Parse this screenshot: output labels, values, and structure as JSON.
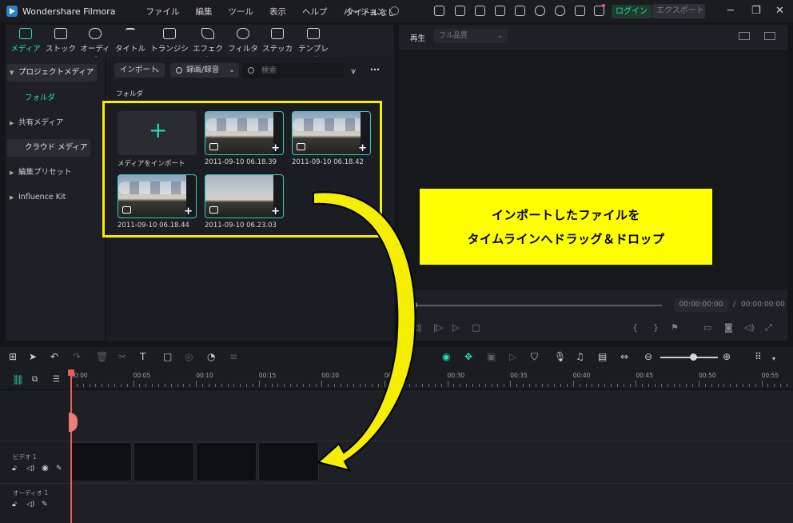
{
  "app": {
    "title": "Wondershare Filmora",
    "project_title": "タイトルなし"
  },
  "menu": [
    "ファイル",
    "編集",
    "ツール",
    "表示",
    "ヘルプ",
    "バージョン"
  ],
  "header": {
    "login_label": "ログイン",
    "export_label": "エクスポート"
  },
  "tools": [
    {
      "label": "メディア",
      "icon": "media-icon"
    },
    {
      "label": "ストック",
      "icon": "stock-icon"
    },
    {
      "label": "オーディオ",
      "icon": "audio-icon"
    },
    {
      "label": "タイトル",
      "icon": "title-icon"
    },
    {
      "label": "トランジション",
      "icon": "transition-icon"
    },
    {
      "label": "エフェクト",
      "icon": "effect-icon"
    },
    {
      "label": "フィルター",
      "icon": "filter-icon"
    },
    {
      "label": "ステッカー",
      "icon": "sticker-icon"
    },
    {
      "label": "テンプレート",
      "icon": "template-icon"
    }
  ],
  "sidebar": {
    "items": [
      "プロジェクトメディア",
      "フォルダ",
      "共有メディア",
      "クラウド メディア",
      "編集プリセット",
      "Influence Kit"
    ]
  },
  "media": {
    "import_dropdown": "インポート",
    "record_dropdown": "録画/録音",
    "search_placeholder": "検索",
    "folder_label": "フォルダ",
    "import_tile_label": "メディアをインポート",
    "clips": [
      "2011-09-10 06.18.39",
      "2011-09-10 06.18.42",
      "2011-09-10 06.18.44",
      "2011-09-10 06.23.03"
    ]
  },
  "player": {
    "label": "再生",
    "quality": "フル品質",
    "timecode_current": "00:00:00:00",
    "timecode_separator": "/",
    "timecode_total": "00:00:00:00"
  },
  "annotation": {
    "line1": "インポートしたファイルを",
    "line2": "タイムラインへドラッグ＆ドロップ"
  },
  "timeline": {
    "ruler": [
      "00:00",
      "00:05",
      "00:10",
      "00:15",
      "00:20",
      "00:25",
      "00:30",
      "00:35",
      "00:40",
      "00:45",
      "00:50",
      "00:55"
    ],
    "video_track_label": "ビデオ 1",
    "audio_track_label": "オーディオ 1"
  },
  "colors": {
    "accent": "#29e0b8",
    "annotation_bg": "#ffff00",
    "highlight_border": "#f4ee00",
    "playhead": "#ef5b5b"
  }
}
